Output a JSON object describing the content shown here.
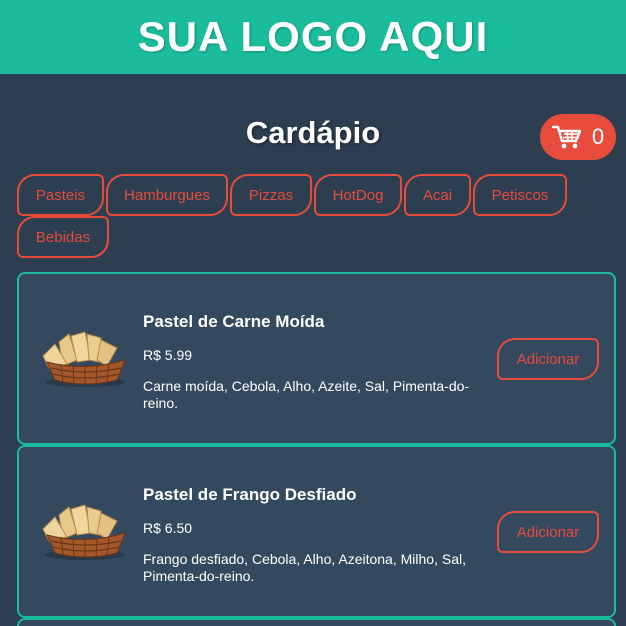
{
  "header": {
    "logo_text": "SUA LOGO AQUI"
  },
  "page": {
    "title": "Cardápio"
  },
  "cart": {
    "count": "0",
    "icon": "shopping-cart-icon"
  },
  "categories": [
    "Pasteis",
    "Hamburgues",
    "Pizzas",
    "HotDog",
    "Acai",
    "Petiscos",
    "Bebidas"
  ],
  "products": [
    {
      "name": "Pastel de Carne Moída",
      "price": "R$ 5.99",
      "description": "Carne moída, Cebola, Alho, Azeite, Sal, Pimenta-do-reino.",
      "button": "Adicionar",
      "image": "pastel-basket-image"
    },
    {
      "name": "Pastel de Frango Desfiado",
      "price": "R$ 6.50",
      "description": "Frango desfiado, Cebola, Alho, Azeitona, Milho, Sal, Pimenta-do-reino.",
      "button": "Adicionar",
      "image": "pastel-basket-image"
    }
  ],
  "colors": {
    "background": "#2c3e50",
    "header": "#1abc9c",
    "accent": "#e74c3c",
    "card": "#34495e"
  }
}
